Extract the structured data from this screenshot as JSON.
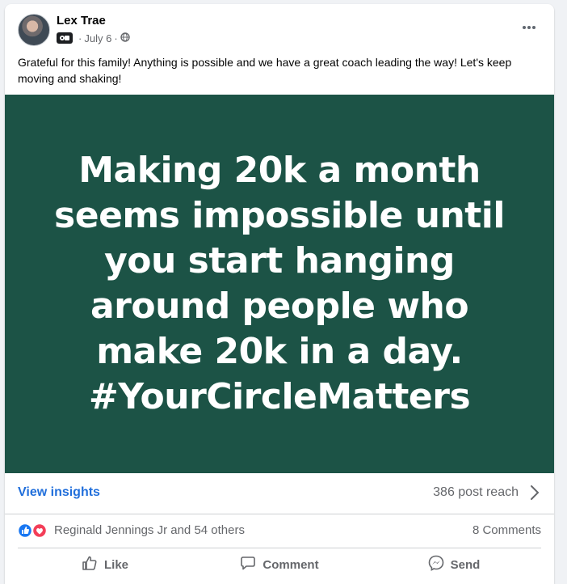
{
  "post": {
    "author": "Lex Trae",
    "date": "July 6",
    "dot": "·",
    "audience_icon": "public-globe-icon",
    "caption": "Grateful for this family! Anything is possible and we have a great coach leading the way! Let's keep moving and shaking!",
    "image_text": "Making 20k a month\nseems impossible until\nyou start hanging\naround people who\nmake 20k in a day.\n#YourCircleMatters",
    "image_bg": "#1c5346"
  },
  "insights": {
    "link_label": "View insights",
    "reach": "386 post reach"
  },
  "reactions": {
    "names": "Reginald Jennings Jr and 54 others",
    "comments": "8 Comments",
    "icons": [
      "like-reaction-icon",
      "love-reaction-icon"
    ]
  },
  "actions": {
    "like": "Like",
    "comment": "Comment",
    "send": "Send"
  },
  "colors": {
    "accent": "#216fdb",
    "like_blue": "#1877f2",
    "love_red": "#f33e58"
  }
}
